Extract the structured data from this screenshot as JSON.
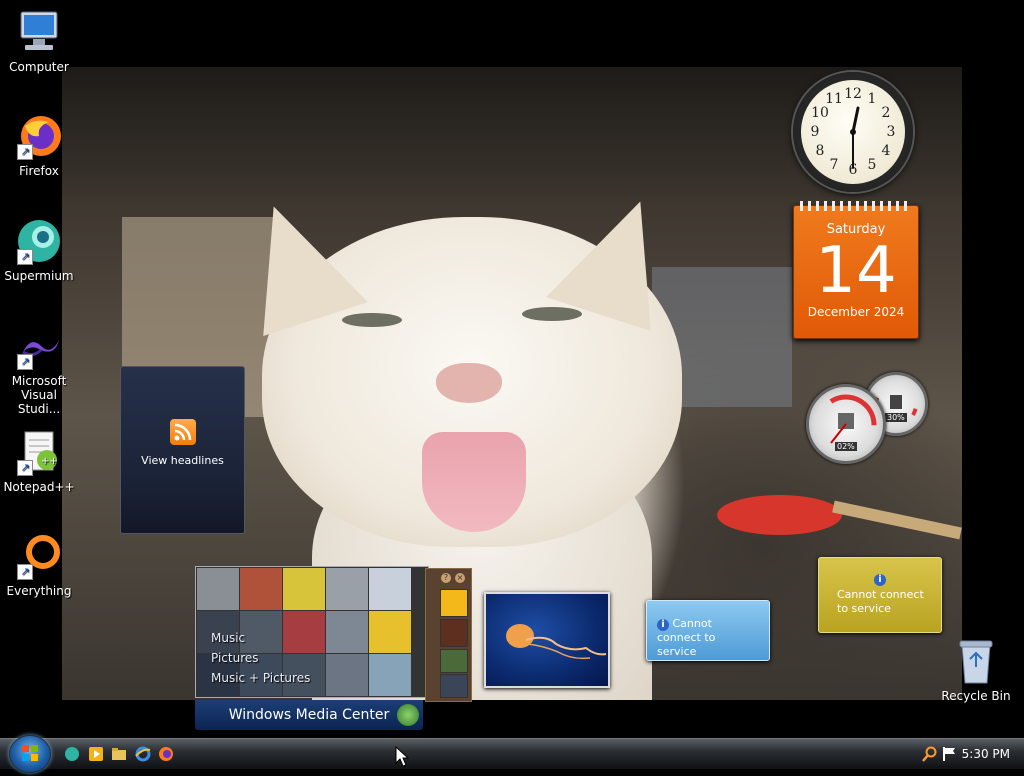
{
  "desktop": {
    "icons": [
      {
        "label": "Computer",
        "icon": "computer-icon",
        "shortcut": false
      },
      {
        "label": "Firefox",
        "icon": "firefox-icon",
        "shortcut": true
      },
      {
        "label": "Supermium",
        "icon": "supermium-icon",
        "shortcut": true
      },
      {
        "label": "Microsoft\nVisual Studi...",
        "icon": "visual-studio-icon",
        "shortcut": true
      },
      {
        "label": "Notepad++",
        "icon": "notepad-plus-plus-icon",
        "shortcut": true
      },
      {
        "label": "Everything",
        "icon": "everything-search-icon",
        "shortcut": true
      }
    ],
    "recycle_bin": {
      "label": "Recycle Bin",
      "icon": "recycle-bin-icon"
    }
  },
  "gadgets": {
    "clock": {
      "numbers": [
        "12",
        "1",
        "2",
        "3",
        "4",
        "5",
        "6",
        "7",
        "8",
        "9",
        "10",
        "11"
      ],
      "time_shown": "5:30"
    },
    "calendar": {
      "weekday": "Saturday",
      "day": "14",
      "month_year": "December 2024"
    },
    "feed_headlines": {
      "label": "View headlines",
      "icon": "rss-icon"
    },
    "cpu_meter": {
      "cpu_label": "02%",
      "memory_label": "30%",
      "cpu_value": 2,
      "memory_value": 30
    },
    "media_center": {
      "menu": [
        "Music",
        "Pictures",
        "Music + Pictures"
      ],
      "title": "Windows Media Center"
    },
    "weather": {
      "message": "Cannot connect to service"
    },
    "currency": {
      "message": "Cannot connect to service"
    }
  },
  "taskbar": {
    "start_button": "start-orb-icon",
    "quick_launch": [
      "supermium-icon",
      "media-player-icon",
      "folder-icon",
      "internet-explorer-icon",
      "firefox-icon"
    ],
    "tray_icons": [
      "search-icon",
      "flag-icon"
    ],
    "clock": "5:30 PM"
  },
  "colors": {
    "calendar": "#e8650d",
    "taskbar": "#1d2024",
    "weather": "#6ab3e6",
    "currency": "#c9b334"
  }
}
